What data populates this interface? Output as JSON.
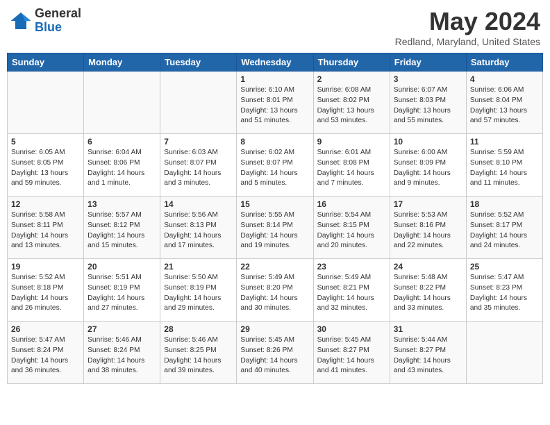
{
  "header": {
    "logo_general": "General",
    "logo_blue": "Blue",
    "month_year": "May 2024",
    "location": "Redland, Maryland, United States"
  },
  "days_of_week": [
    "Sunday",
    "Monday",
    "Tuesday",
    "Wednesday",
    "Thursday",
    "Friday",
    "Saturday"
  ],
  "weeks": [
    [
      {
        "day": "",
        "info": ""
      },
      {
        "day": "",
        "info": ""
      },
      {
        "day": "",
        "info": ""
      },
      {
        "day": "1",
        "info": "Sunrise: 6:10 AM\nSunset: 8:01 PM\nDaylight: 13 hours\nand 51 minutes."
      },
      {
        "day": "2",
        "info": "Sunrise: 6:08 AM\nSunset: 8:02 PM\nDaylight: 13 hours\nand 53 minutes."
      },
      {
        "day": "3",
        "info": "Sunrise: 6:07 AM\nSunset: 8:03 PM\nDaylight: 13 hours\nand 55 minutes."
      },
      {
        "day": "4",
        "info": "Sunrise: 6:06 AM\nSunset: 8:04 PM\nDaylight: 13 hours\nand 57 minutes."
      }
    ],
    [
      {
        "day": "5",
        "info": "Sunrise: 6:05 AM\nSunset: 8:05 PM\nDaylight: 13 hours\nand 59 minutes."
      },
      {
        "day": "6",
        "info": "Sunrise: 6:04 AM\nSunset: 8:06 PM\nDaylight: 14 hours\nand 1 minute."
      },
      {
        "day": "7",
        "info": "Sunrise: 6:03 AM\nSunset: 8:07 PM\nDaylight: 14 hours\nand 3 minutes."
      },
      {
        "day": "8",
        "info": "Sunrise: 6:02 AM\nSunset: 8:07 PM\nDaylight: 14 hours\nand 5 minutes."
      },
      {
        "day": "9",
        "info": "Sunrise: 6:01 AM\nSunset: 8:08 PM\nDaylight: 14 hours\nand 7 minutes."
      },
      {
        "day": "10",
        "info": "Sunrise: 6:00 AM\nSunset: 8:09 PM\nDaylight: 14 hours\nand 9 minutes."
      },
      {
        "day": "11",
        "info": "Sunrise: 5:59 AM\nSunset: 8:10 PM\nDaylight: 14 hours\nand 11 minutes."
      }
    ],
    [
      {
        "day": "12",
        "info": "Sunrise: 5:58 AM\nSunset: 8:11 PM\nDaylight: 14 hours\nand 13 minutes."
      },
      {
        "day": "13",
        "info": "Sunrise: 5:57 AM\nSunset: 8:12 PM\nDaylight: 14 hours\nand 15 minutes."
      },
      {
        "day": "14",
        "info": "Sunrise: 5:56 AM\nSunset: 8:13 PM\nDaylight: 14 hours\nand 17 minutes."
      },
      {
        "day": "15",
        "info": "Sunrise: 5:55 AM\nSunset: 8:14 PM\nDaylight: 14 hours\nand 19 minutes."
      },
      {
        "day": "16",
        "info": "Sunrise: 5:54 AM\nSunset: 8:15 PM\nDaylight: 14 hours\nand 20 minutes."
      },
      {
        "day": "17",
        "info": "Sunrise: 5:53 AM\nSunset: 8:16 PM\nDaylight: 14 hours\nand 22 minutes."
      },
      {
        "day": "18",
        "info": "Sunrise: 5:52 AM\nSunset: 8:17 PM\nDaylight: 14 hours\nand 24 minutes."
      }
    ],
    [
      {
        "day": "19",
        "info": "Sunrise: 5:52 AM\nSunset: 8:18 PM\nDaylight: 14 hours\nand 26 minutes."
      },
      {
        "day": "20",
        "info": "Sunrise: 5:51 AM\nSunset: 8:19 PM\nDaylight: 14 hours\nand 27 minutes."
      },
      {
        "day": "21",
        "info": "Sunrise: 5:50 AM\nSunset: 8:19 PM\nDaylight: 14 hours\nand 29 minutes."
      },
      {
        "day": "22",
        "info": "Sunrise: 5:49 AM\nSunset: 8:20 PM\nDaylight: 14 hours\nand 30 minutes."
      },
      {
        "day": "23",
        "info": "Sunrise: 5:49 AM\nSunset: 8:21 PM\nDaylight: 14 hours\nand 32 minutes."
      },
      {
        "day": "24",
        "info": "Sunrise: 5:48 AM\nSunset: 8:22 PM\nDaylight: 14 hours\nand 33 minutes."
      },
      {
        "day": "25",
        "info": "Sunrise: 5:47 AM\nSunset: 8:23 PM\nDaylight: 14 hours\nand 35 minutes."
      }
    ],
    [
      {
        "day": "26",
        "info": "Sunrise: 5:47 AM\nSunset: 8:24 PM\nDaylight: 14 hours\nand 36 minutes."
      },
      {
        "day": "27",
        "info": "Sunrise: 5:46 AM\nSunset: 8:24 PM\nDaylight: 14 hours\nand 38 minutes."
      },
      {
        "day": "28",
        "info": "Sunrise: 5:46 AM\nSunset: 8:25 PM\nDaylight: 14 hours\nand 39 minutes."
      },
      {
        "day": "29",
        "info": "Sunrise: 5:45 AM\nSunset: 8:26 PM\nDaylight: 14 hours\nand 40 minutes."
      },
      {
        "day": "30",
        "info": "Sunrise: 5:45 AM\nSunset: 8:27 PM\nDaylight: 14 hours\nand 41 minutes."
      },
      {
        "day": "31",
        "info": "Sunrise: 5:44 AM\nSunset: 8:27 PM\nDaylight: 14 hours\nand 43 minutes."
      },
      {
        "day": "",
        "info": ""
      }
    ]
  ]
}
